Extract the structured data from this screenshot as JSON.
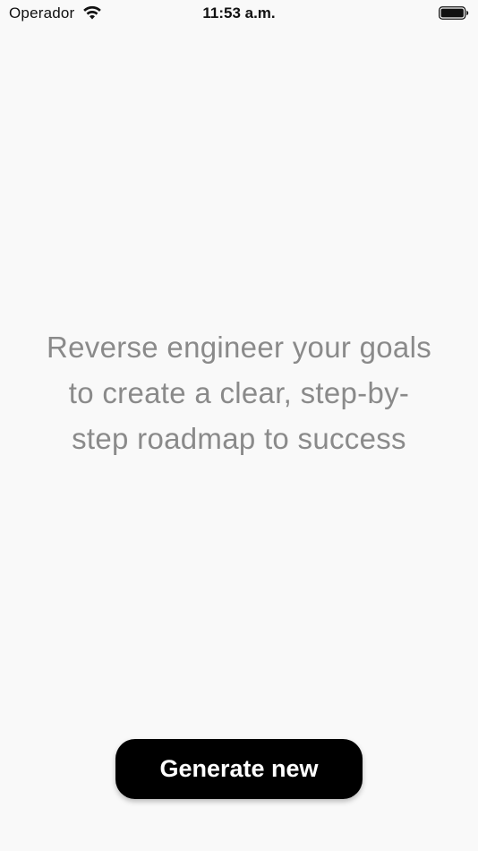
{
  "status_bar": {
    "carrier": "Operador",
    "time": "11:53 a.m.",
    "wifi_icon": "wifi-icon",
    "battery_icon": "battery-icon"
  },
  "main": {
    "tagline_line1": "Reverse engineer your goals",
    "tagline_line2": "to create a clear, step-by-",
    "tagline_line3": "step roadmap to success"
  },
  "actions": {
    "generate_label": "Generate new"
  },
  "colors": {
    "background": "#f9f9f9",
    "tagline_text": "#8a8a8a",
    "button_bg": "#000000",
    "button_text": "#ffffff"
  }
}
